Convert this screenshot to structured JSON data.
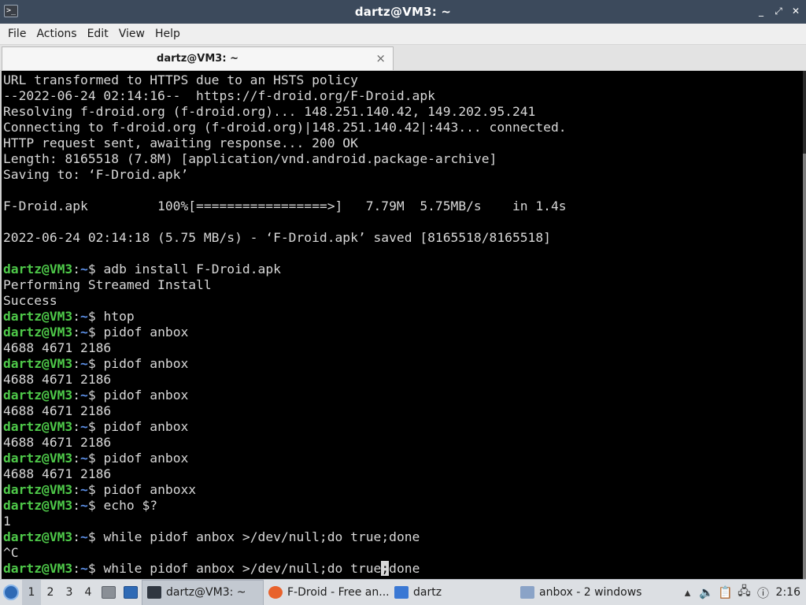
{
  "window": {
    "icon": ">_",
    "title": "dartz@VM3: ~",
    "controls": {
      "minimize": "_",
      "maximize": "⤢",
      "close": "✕"
    }
  },
  "menu": [
    "File",
    "Actions",
    "Edit",
    "View",
    "Help"
  ],
  "tab": {
    "label": "dartz@VM3: ~",
    "close": "×"
  },
  "colors": {
    "prompt": "#4ec949",
    "path": "#5c8fe6",
    "text": "#d8d8d8",
    "background": "#000000"
  },
  "terminal": {
    "prompt_user": "dartz@VM3",
    "prompt_path": "~",
    "prompt_sep": ":",
    "prompt_symbol": "$ ",
    "lines": [
      {
        "type": "text",
        "text": "URL transformed to HTTPS due to an HSTS policy"
      },
      {
        "type": "text",
        "text": "--2022-06-24 02:14:16--  https://f-droid.org/F-Droid.apk"
      },
      {
        "type": "text",
        "text": "Resolving f-droid.org (f-droid.org)... 148.251.140.42, 149.202.95.241"
      },
      {
        "type": "text",
        "text": "Connecting to f-droid.org (f-droid.org)|148.251.140.42|:443... connected."
      },
      {
        "type": "text",
        "text": "HTTP request sent, awaiting response... 200 OK"
      },
      {
        "type": "text",
        "text": "Length: 8165518 (7.8M) [application/vnd.android.package-archive]"
      },
      {
        "type": "text",
        "text": "Saving to: ‘F-Droid.apk’"
      },
      {
        "type": "text",
        "text": ""
      },
      {
        "type": "text",
        "text": "F-Droid.apk         100%[=================>]   7.79M  5.75MB/s    in 1.4s"
      },
      {
        "type": "text",
        "text": ""
      },
      {
        "type": "text",
        "text": "2022-06-24 02:14:18 (5.75 MB/s) - ‘F-Droid.apk’ saved [8165518/8165518]"
      },
      {
        "type": "text",
        "text": ""
      },
      {
        "type": "cmd",
        "text": "adb install F-Droid.apk"
      },
      {
        "type": "text",
        "text": "Performing Streamed Install"
      },
      {
        "type": "text",
        "text": "Success"
      },
      {
        "type": "cmd",
        "text": "htop"
      },
      {
        "type": "cmd",
        "text": "pidof anbox"
      },
      {
        "type": "text",
        "text": "4688 4671 2186"
      },
      {
        "type": "cmd",
        "text": "pidof anbox"
      },
      {
        "type": "text",
        "text": "4688 4671 2186"
      },
      {
        "type": "cmd",
        "text": "pidof anbox"
      },
      {
        "type": "text",
        "text": "4688 4671 2186"
      },
      {
        "type": "cmd",
        "text": "pidof anbox"
      },
      {
        "type": "text",
        "text": "4688 4671 2186"
      },
      {
        "type": "cmd",
        "text": "pidof anbox"
      },
      {
        "type": "text",
        "text": "4688 4671 2186"
      },
      {
        "type": "cmd",
        "text": "pidof anboxx"
      },
      {
        "type": "cmd",
        "text": "echo $?"
      },
      {
        "type": "text",
        "text": "1"
      },
      {
        "type": "cmd",
        "text": "while pidof anbox >/dev/null;do true;done"
      },
      {
        "type": "text",
        "text": "^C"
      },
      {
        "type": "cmd_cursor",
        "before": "while pidof anbox >/dev/null;do true",
        "cursor": ";",
        "after": "done"
      }
    ]
  },
  "taskbar": {
    "workspaces": [
      "1",
      "2",
      "3",
      "4"
    ],
    "active_workspace": "1",
    "tasks": [
      {
        "label": "dartz@VM3: ~",
        "icon": "terminal-icon",
        "color": "#2f3640",
        "active": true
      },
      {
        "label": "F-Droid - Free an...",
        "icon": "firefox-icon",
        "color": "#e8622c",
        "active": false
      },
      {
        "label": "dartz",
        "icon": "folder-icon",
        "color": "#3a78d4",
        "active": false
      },
      {
        "label": "anbox - 2 windows",
        "icon": "window-icon",
        "color": "#8aa3c7",
        "active": false
      }
    ],
    "tray_icons": [
      "up-arrow-icon",
      "volume-icon",
      "clipboard-icon",
      "network-icon",
      "notification-icon"
    ],
    "clock": "2:16"
  }
}
